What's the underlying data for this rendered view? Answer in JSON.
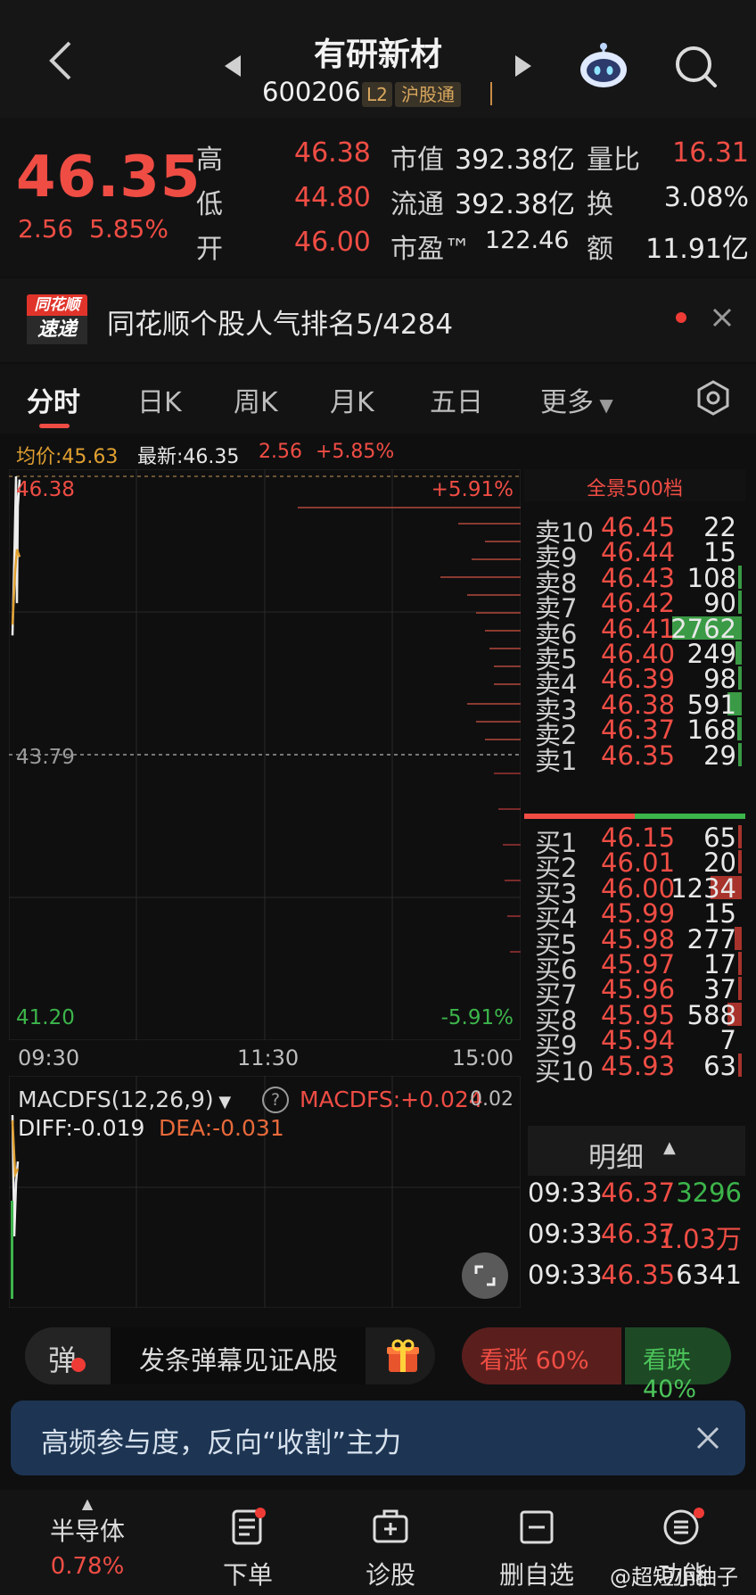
{
  "header": {
    "stock_name": "有研新材",
    "stock_code": "600206",
    "l2_tag": "L2",
    "connect_tag": "沪股通"
  },
  "quote": {
    "price": "46.35",
    "change": "2.56",
    "change_pct": "5.85%",
    "rows": [
      {
        "l1": "高",
        "v1": "46.38",
        "l2": "市值",
        "v2": "392.38亿",
        "l3": "量比",
        "v3": "16.31"
      },
      {
        "l1": "低",
        "v1": "44.80",
        "l2": "流通",
        "v2": "392.38亿",
        "l3": "换",
        "v3": "3.08%"
      },
      {
        "l1": "开",
        "v1": "46.00",
        "l2": "市盈™",
        "v2": "122.46",
        "l3": "额",
        "v3": "11.91亿"
      }
    ]
  },
  "news": {
    "logo_top": "同花顺",
    "logo_bottom": "速递",
    "text": "同花顺个股人气排名5/4284"
  },
  "tabs": [
    "分时",
    "日K",
    "周K",
    "月K",
    "五日",
    "更多"
  ],
  "info_line": {
    "avg": "均价:45.63",
    "latest": "最新:46.35",
    "change": "2.56",
    "change_pct": "+5.85%"
  },
  "chart_data": {
    "type": "line",
    "series": [
      {
        "values": [
          44.9,
          45.6,
          46.38,
          45.2,
          46.1,
          46.35
        ]
      },
      {
        "values": [
          45.0,
          45.5,
          45.7,
          45.63
        ]
      }
    ],
    "y_top_label": "46.38",
    "y_mid_label": "43.79",
    "y_bottom_label": "41.20",
    "pct_top_label": "+5.91%",
    "pct_bottom_label": "-5.91%",
    "x_ticks": [
      "09:30",
      "11:30",
      "15:00"
    ],
    "ylim": [
      41.2,
      46.38
    ]
  },
  "macd": {
    "indicator": "MACDFS(12,26,9)",
    "value": "MACDFS:+0.024",
    "right_label": "0.02",
    "diff": "DIFF:-0.019",
    "dea": "DEA:-0.031"
  },
  "order_book": {
    "title": "全景500档",
    "sells": [
      {
        "label": "卖10",
        "price": "46.45",
        "vol": "22",
        "bar": 0.0
      },
      {
        "label": "卖9",
        "price": "46.44",
        "vol": "15",
        "bar": 0.0
      },
      {
        "label": "卖8",
        "price": "46.43",
        "vol": "108",
        "bar": 0.04
      },
      {
        "label": "卖7",
        "price": "46.42",
        "vol": "90",
        "bar": 0.03
      },
      {
        "label": "卖6",
        "price": "46.41",
        "vol": "2762",
        "bar": 1.0
      },
      {
        "label": "卖5",
        "price": "46.40",
        "vol": "249",
        "bar": 0.09
      },
      {
        "label": "卖4",
        "price": "46.39",
        "vol": "98",
        "bar": 0.04
      },
      {
        "label": "卖3",
        "price": "46.38",
        "vol": "591",
        "bar": 0.21
      },
      {
        "label": "卖2",
        "price": "46.37",
        "vol": "168",
        "bar": 0.06
      },
      {
        "label": "卖1",
        "price": "46.35",
        "vol": "29",
        "bar": 0.01
      }
    ],
    "buys": [
      {
        "label": "买1",
        "price": "46.15",
        "vol": "65",
        "bar": 0.02
      },
      {
        "label": "买2",
        "price": "46.01",
        "vol": "20",
        "bar": 0.01
      },
      {
        "label": "买3",
        "price": "46.00",
        "vol": "1234",
        "bar": 0.45
      },
      {
        "label": "买4",
        "price": "45.99",
        "vol": "15",
        "bar": 0.0
      },
      {
        "label": "买5",
        "price": "45.98",
        "vol": "277",
        "bar": 0.1
      },
      {
        "label": "买6",
        "price": "45.97",
        "vol": "17",
        "bar": 0.01
      },
      {
        "label": "买7",
        "price": "45.96",
        "vol": "37",
        "bar": 0.01
      },
      {
        "label": "买8",
        "price": "45.95",
        "vol": "588",
        "bar": 0.21
      },
      {
        "label": "买9",
        "price": "45.94",
        "vol": "7",
        "bar": 0.0
      },
      {
        "label": "买10",
        "price": "45.93",
        "vol": "63",
        "bar": 0.02
      }
    ],
    "sell_ratio": 0.5
  },
  "detail": {
    "title": "明细",
    "rows": [
      {
        "time": "09:33",
        "price": "46.37",
        "vol": "3296",
        "color": "#3cb54a"
      },
      {
        "time": "09:33",
        "price": "46.37",
        "vol": "1.03万",
        "color": "#ef4d44"
      },
      {
        "time": "09:33",
        "price": "46.35",
        "vol": "6341",
        "color": "#e8e8e8"
      }
    ]
  },
  "danmu": {
    "badge": "弹",
    "text": "发条弹幕见证A股"
  },
  "vote": {
    "up": "看涨 60%",
    "down": "看跌 40%",
    "up_ratio": 0.6
  },
  "promo": {
    "text": "高频参与度，反向“收割”主力"
  },
  "nav": {
    "sector_name": "半导体",
    "sector_pct": "0.78%",
    "items": [
      "下单",
      "诊股",
      "删自选",
      "功能"
    ]
  },
  "watermark": "@超短小柚子",
  "colors": {
    "up": "#ef4d44",
    "down": "#3cb54a",
    "avg": "#e0a030",
    "bg": "#0f0f10"
  }
}
